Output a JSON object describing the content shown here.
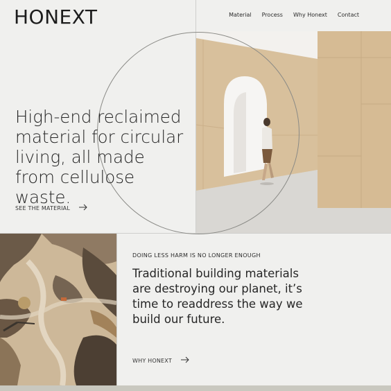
{
  "brand": {
    "logo": "HONEXT"
  },
  "nav": {
    "items": [
      "Material",
      "Process",
      "Why Honext",
      "Contact"
    ]
  },
  "hero": {
    "title": "High-end reclaimed material for circular living, all made from cellulose waste.",
    "cta_label": "SEE THE MATERIAL",
    "image_icon": "hallway-photo"
  },
  "section2": {
    "eyebrow": "DOING LESS HARM IS NO LONGER ENOUGH",
    "body": "Traditional building materials are destroying our planet, it’s time to readdress the way we build our future.",
    "cta_label": "WHY HONEXT",
    "image_icon": "aerial-landfill-photo"
  },
  "colors": {
    "background": "#f0f0ee",
    "text": "#222222",
    "panel_wood": "#cfb48f"
  }
}
